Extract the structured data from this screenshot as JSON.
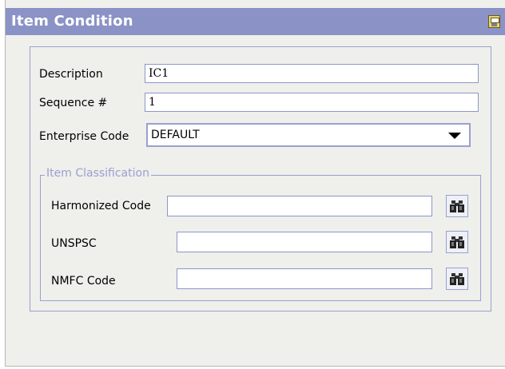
{
  "window": {
    "title": "Item Condition"
  },
  "form": {
    "description": {
      "label": "Description",
      "value": "IC1"
    },
    "sequence": {
      "label": "Sequence #",
      "value": "1"
    },
    "enterprise": {
      "label": "Enterprise Code",
      "value": "DEFAULT"
    }
  },
  "classification": {
    "legend": "Item Classification",
    "harmonized": {
      "label": "Harmonized Code",
      "value": ""
    },
    "unspsc": {
      "label": "UNSPSC",
      "value": ""
    },
    "nmfc": {
      "label": "NMFC Code",
      "value": ""
    }
  },
  "icons": {
    "save": "save-disk-icon",
    "lookup": "binoculars-icon"
  }
}
